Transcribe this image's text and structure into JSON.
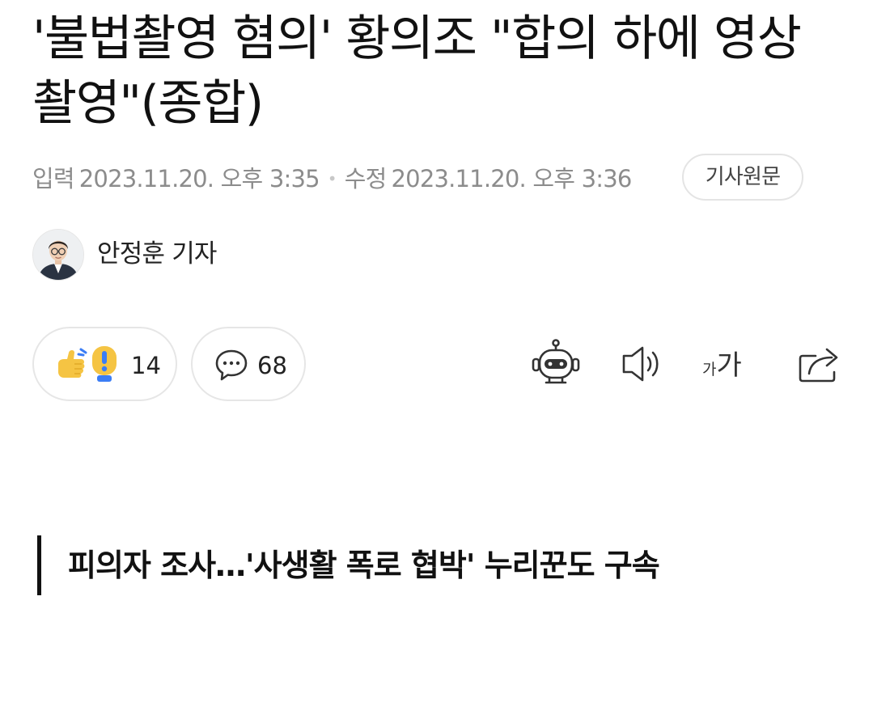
{
  "article": {
    "headline": "'불법촬영 혐의' 황의조 \"합의 하에 영상 촬영\"(종합)",
    "input_label": "입력",
    "input_time": "2023.11.20. 오후 3:35",
    "edit_label": "수정",
    "edit_time": "2023.11.20. 오후 3:36",
    "original_button": "기사원문",
    "author_name": "안정훈 기자",
    "subheading": "피의자 조사…'사생활 폭로 협박' 누리꾼도 구속"
  },
  "actions": {
    "reaction_count": "14",
    "comment_count": "68",
    "font_small": "가",
    "font_large": "가"
  },
  "icons": {
    "reaction": "thumbs-up-exclaim-icon",
    "comment": "speech-bubble-icon",
    "summary_bot": "robot-icon",
    "listen": "speaker-icon",
    "font_size": "font-size-icon",
    "share": "share-icon"
  },
  "colors": {
    "reaction_yellow": "#f5c443",
    "reaction_blue": "#3b7df5",
    "meta_gray": "#8c8c8c",
    "border_gray": "#e6e6e6"
  }
}
